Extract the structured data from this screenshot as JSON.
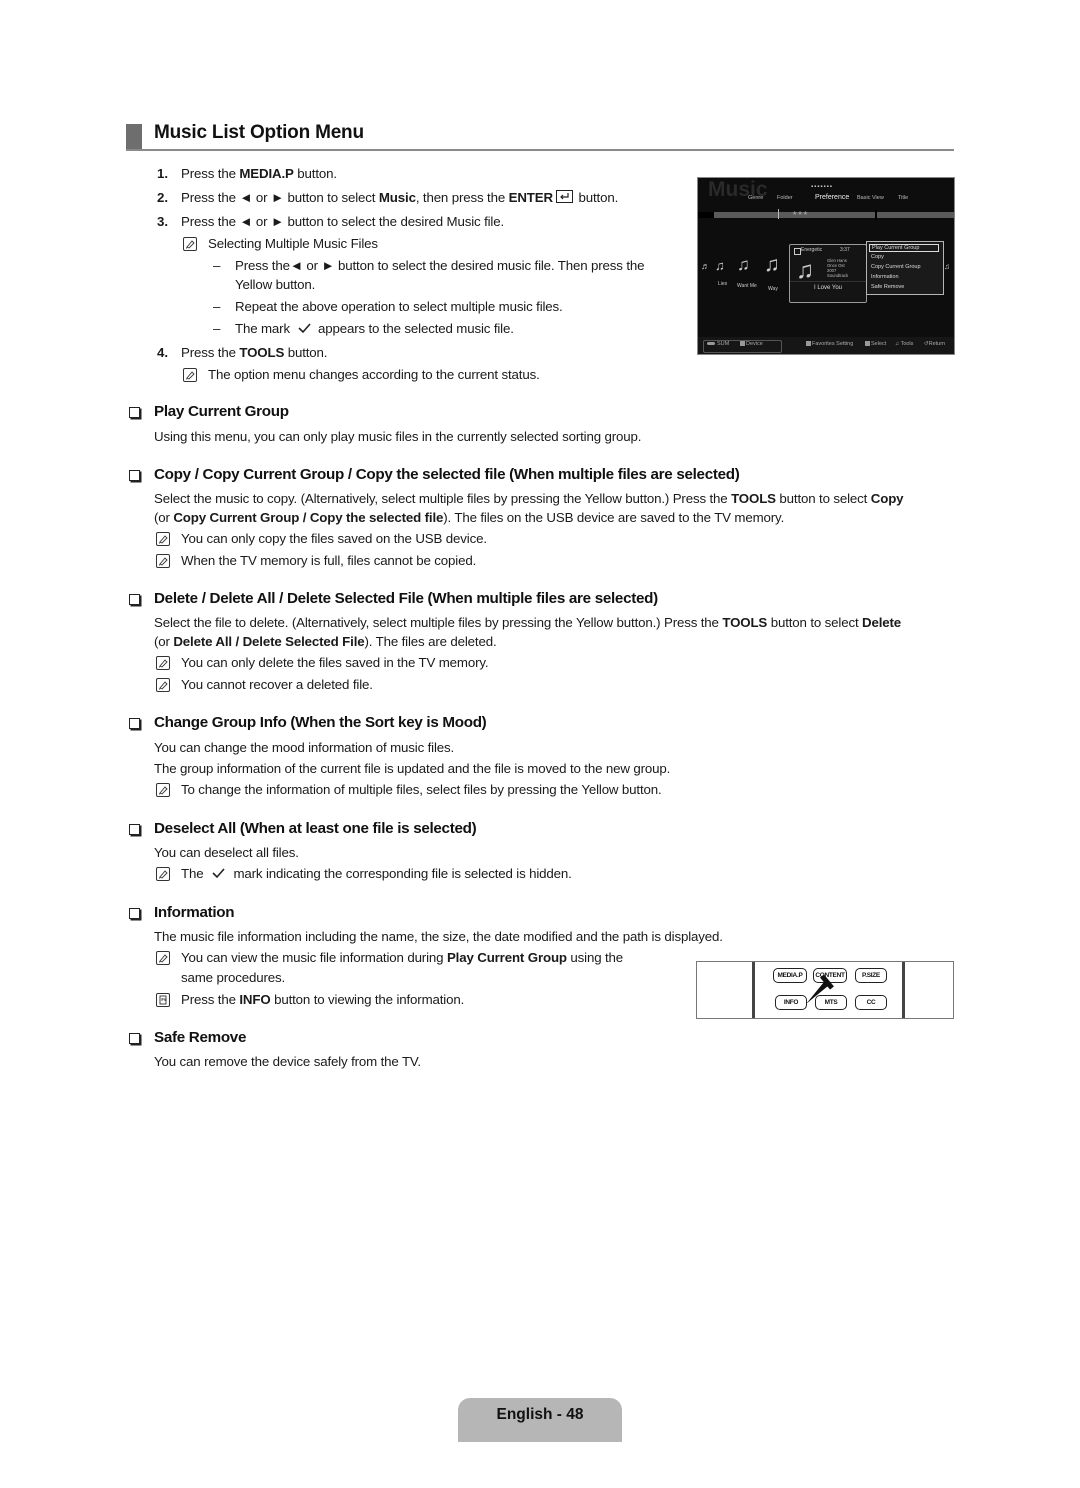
{
  "title": "Music List Option Menu",
  "steps": [
    {
      "num": "1.",
      "pre": "Press the ",
      "bold": "MEDIA.P",
      "post": " button."
    },
    {
      "num": "2.",
      "pre": "Press the ◄ or ► button to select ",
      "bold": "Music",
      "mid": ", then press the ",
      "bold2": "ENTER",
      "post": " button."
    },
    {
      "num": "3.",
      "text": "Press the ◄ or ► button to select the desired Music file."
    },
    {
      "num": "4.",
      "pre": "Press the ",
      "bold": "TOOLS",
      "post": " button."
    }
  ],
  "step3_note": "Selecting Multiple Music Files",
  "step3_sub": [
    "Press the◄ or ► button to select the desired music file. Then press the",
    "Yellow button.",
    "Repeat the above operation to select multiple music files.",
    "The mark",
    "appears to the selected music file."
  ],
  "step4_note": "The option menu changes according to the current status.",
  "tv_screen": {
    "title": "Music",
    "dots": "▪▪▪▪▪▪▪",
    "tabs": [
      "Genre",
      "Folder",
      "Preference",
      "Basic View",
      "Title"
    ],
    "stars": "★★★",
    "tracks": [
      "Lies",
      "Want Me",
      "Way"
    ],
    "card": {
      "mood": "Energetic",
      "time": "3:37",
      "meta": [
        "Glen Hans",
        "Once Ost",
        "2007",
        "Soundtrack"
      ],
      "song": "I Love You"
    },
    "menu": [
      "Play Current Group",
      "Copy",
      "Copy Current Group",
      "Information",
      "Safe Remove"
    ],
    "footer": {
      "sum": "SUM",
      "device": "Device",
      "favorites": "Favorites Setting",
      "select": "Select",
      "tools": "Tools",
      "return": "Return"
    }
  },
  "sections": {
    "play_current_group": {
      "heading": "Play Current Group",
      "body": "Using this menu, you can only play music files in the currently selected sorting group."
    },
    "copy": {
      "heading": "Copy / Copy Current Group / Copy the selected file (When multiple files are selected)",
      "body1_pre": "Select the music to copy. (Alternatively, select multiple files by pressing the Yellow button.) Press the ",
      "body1_b1": "TOOLS",
      "body1_mid": " button to select ",
      "body1_b2": "Copy",
      "body2_pre": "(or ",
      "body2_b": "Copy Current Group / Copy the selected file",
      "body2_post": "). The files on the USB device are saved to the TV memory.",
      "notes": [
        "You can only copy the files saved on the USB device.",
        "When the TV memory is full, files cannot be copied."
      ]
    },
    "delete": {
      "heading": "Delete / Delete All / Delete Selected File (When multiple files are selected)",
      "body1_pre": "Select the file to delete. (Alternatively, select multiple files by pressing the Yellow button.) Press the ",
      "body1_b1": "TOOLS",
      "body1_mid": " button to select ",
      "body1_b2": "Delete",
      "body2_pre": "(or ",
      "body2_b": "Delete All / Delete Selected File",
      "body2_post": "). The files are deleted.",
      "notes": [
        "You can only delete the files saved in the TV memory.",
        "You cannot recover a deleted file."
      ]
    },
    "change_group": {
      "heading": "Change Group Info (When the Sort key is Mood)",
      "lines": [
        "You can change the mood information of music files.",
        "The group information of the current file is updated and the file is moved to the new group."
      ],
      "note": "To change the information of multiple files, select files by pressing the Yellow button."
    },
    "deselect": {
      "heading": "Deselect All (When at least one file is selected)",
      "body": "You can deselect all files.",
      "note_pre": "The",
      "note_post": "mark indicating the corresponding file is selected is hidden."
    },
    "information": {
      "heading": "Information",
      "body": "The music file information including the name, the size, the date modified and the path is displayed.",
      "note1_pre": "You can view the music file information during ",
      "note1_b": "Play Current Group",
      "note1_post": " using the",
      "note1_line2": "same procedures.",
      "note2_pre": "Press the ",
      "note2_b": "INFO",
      "note2_post": " button to viewing the information."
    },
    "safe_remove": {
      "heading": "Safe Remove",
      "body": "You can remove the device safely from the TV."
    }
  },
  "remote_buttons": [
    "MEDIA.P",
    "CONTENT",
    "P.SIZE",
    "INFO",
    "MTS",
    "CC"
  ],
  "footer": "English - 48"
}
